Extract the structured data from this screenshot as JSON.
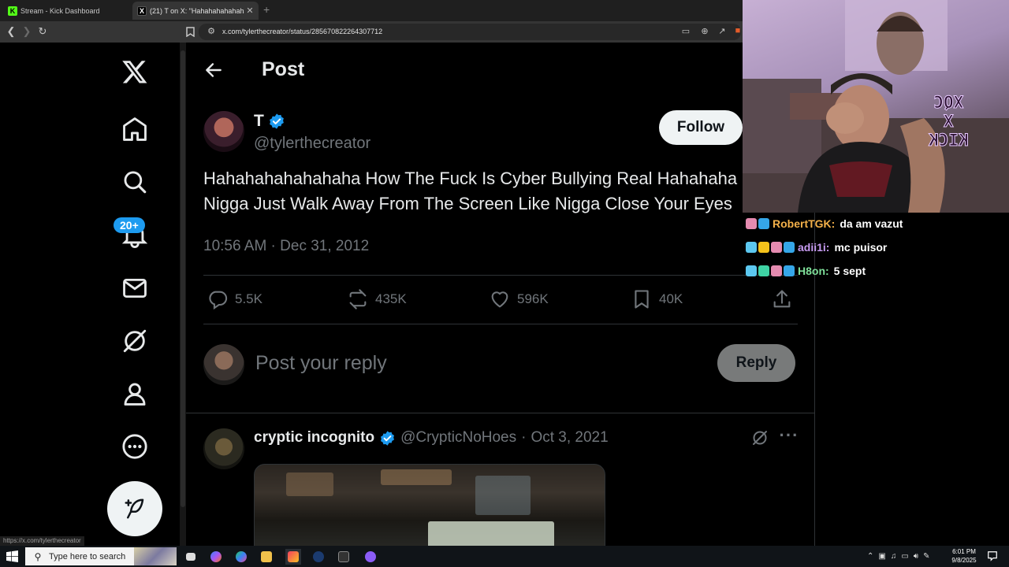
{
  "browser": {
    "tabs": [
      {
        "title": "Stream - Kick Dashboard",
        "favicon": "kick-icon"
      },
      {
        "title": "(21) T on X: \"Hahahahahahahaha",
        "favicon": "x-icon"
      }
    ],
    "new_tab_label": "+",
    "url": "x.com/tylerthecreator/status/285670822264307712",
    "status_link": "https://x.com/tylerthecreator"
  },
  "x_nav": {
    "items": [
      "x-logo",
      "home-icon",
      "search-icon",
      "notifications-icon",
      "messages-icon",
      "grok-icon",
      "profile-icon",
      "more-icon"
    ],
    "notification_badge": "20+",
    "accent": "#1d9bf0"
  },
  "post": {
    "header_title": "Post",
    "author": {
      "name": "T",
      "handle": "@tylerthecreator",
      "verified": true
    },
    "follow_label": "Follow",
    "text": "Hahahahahahahaha How The Fuck Is Cyber Bullying Real Hahahaha\nNigga Just Walk Away From The Screen Like Nigga Close Your Eyes",
    "timestamp": "10:56 AM · Dec 31, 2012",
    "stats": {
      "replies": "5.5K",
      "reposts": "435K",
      "likes": "596K",
      "bookmarks": "40K"
    },
    "reply_placeholder": "Post your reply",
    "reply_button": "Reply"
  },
  "reply_item": {
    "name": "cryptic incognito",
    "handle": "@CrypticNoHoes",
    "separator": "·",
    "date": "Oct 3, 2021",
    "verified": true
  },
  "webcam": {
    "wall_text": "XQC\nX\nKICK"
  },
  "chat": [
    {
      "user": "RobertTGK:",
      "message": "da am vazut",
      "color": "#f4b14a"
    },
    {
      "user": "adii1i:",
      "message": "mc puisor",
      "color": "#c89cf2"
    },
    {
      "user": "H8on:",
      "message": "5 sept",
      "color": "#7fe09a"
    }
  ],
  "taskbar": {
    "search_placeholder": "Type here to search",
    "time": "6:01 PM",
    "date": "9/8/2025"
  }
}
